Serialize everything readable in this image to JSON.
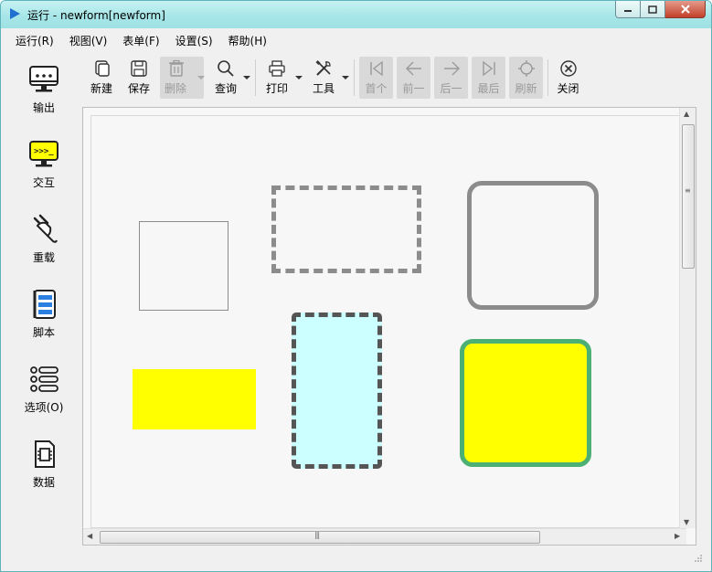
{
  "window": {
    "title": "运行 - newform[newform]"
  },
  "menu": [
    {
      "label": "运行(R)"
    },
    {
      "label": "视图(V)"
    },
    {
      "label": "表单(F)"
    },
    {
      "label": "设置(S)"
    },
    {
      "label": "帮助(H)"
    }
  ],
  "sidebar": [
    {
      "label": "输出",
      "icon": "monitor-output-icon"
    },
    {
      "label": "交互",
      "icon": "terminal-icon"
    },
    {
      "label": "重载",
      "icon": "plug-icon"
    },
    {
      "label": "脚本",
      "icon": "script-book-icon"
    },
    {
      "label": "选项(O)",
      "icon": "options-list-icon"
    },
    {
      "label": "数据",
      "icon": "data-chip-icon"
    }
  ],
  "toolbar": {
    "new": "新建",
    "save": "保存",
    "delete": "删除",
    "query": "查询",
    "print": "打印",
    "tools": "工具",
    "first": "首个",
    "prev": "前一",
    "next": "后一",
    "last": "最后",
    "refresh": "刷新",
    "close": "关闭"
  },
  "colors": {
    "yellow": "#ffff00",
    "cyan": "#ccffff",
    "green_border": "#4caf73",
    "gray_border": "#8c8c8c",
    "dark_dashed": "#555555"
  }
}
